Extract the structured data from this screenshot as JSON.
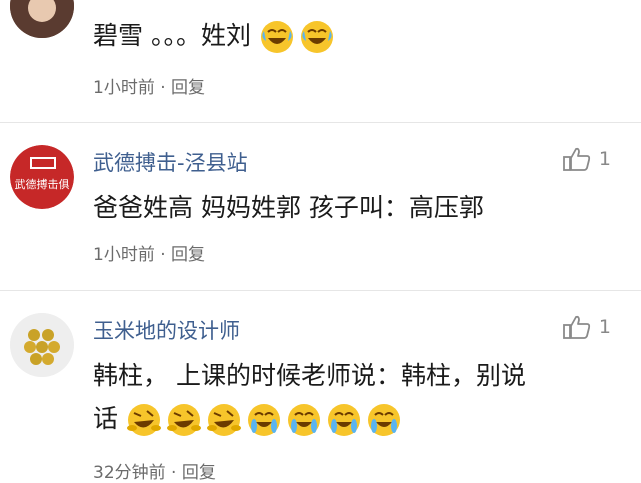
{
  "comments": [
    {
      "username": "",
      "text": "碧雪 。。。姓刘",
      "time": "1小时前",
      "reply": "回复",
      "likes": "",
      "emojis": [
        "laugh-cry",
        "laugh-cry"
      ]
    },
    {
      "username": "武德搏击-泾县站",
      "avatar_text": "武德搏击俱",
      "text": "爸爸姓高 妈妈姓郭 孩子叫：高压郭",
      "time": "1小时前",
      "reply": "回复",
      "likes": "1"
    },
    {
      "username": "玉米地的设计师",
      "text_line1": "韩柱， 上课的时候老师说：韩柱，别说",
      "text_line2": "话",
      "time": "32分钟前",
      "reply": "回复",
      "likes": "1",
      "emojis": [
        "rolling-laugh",
        "rolling-laugh",
        "rolling-laugh",
        "tears-of-joy",
        "tears-of-joy",
        "tears-of-joy",
        "tears-of-joy"
      ]
    }
  ],
  "separator": "·",
  "colors": {
    "username": "#3f5f8f",
    "meta": "#6b6b6b",
    "emoji_yellow": "#f7c52b"
  }
}
